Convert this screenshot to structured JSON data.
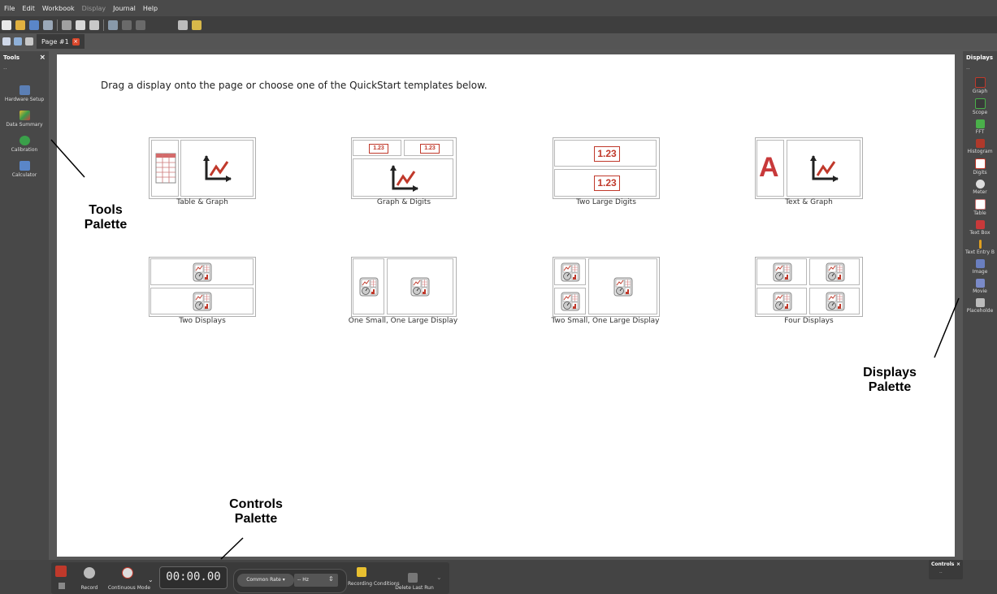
{
  "menu": [
    "File",
    "Edit",
    "Workbook",
    "Display",
    "Journal",
    "Help"
  ],
  "tab": {
    "label": "Page #1",
    "close": "×"
  },
  "tools_palette": {
    "title": "Tools",
    "close": "×",
    "dots": "..",
    "items": [
      {
        "label": "Hardware Setup",
        "icon": "hardware-setup-icon"
      },
      {
        "label": "Data Summary",
        "icon": "data-summary-icon"
      },
      {
        "label": "Calibration",
        "icon": "calibration-icon"
      },
      {
        "label": "Calculator",
        "icon": "calculator-icon"
      }
    ]
  },
  "instruction": "Drag a display onto the page or choose one of the QuickStart templates below.",
  "templates": [
    {
      "label": "Table & Graph"
    },
    {
      "label": "Graph & Digits",
      "digit": "1.23"
    },
    {
      "label": "Two Large Digits",
      "digit": "1.23"
    },
    {
      "label": "Text & Graph",
      "letter": "A"
    },
    {
      "label": "Two Displays"
    },
    {
      "label": "One Small, One Large Display"
    },
    {
      "label": "Two Small, One Large Display"
    },
    {
      "label": "Four Displays"
    }
  ],
  "displays_palette": {
    "title": "Displays",
    "dots": "..",
    "items": [
      {
        "label": "Graph",
        "icon": "graph-icon"
      },
      {
        "label": "Scope",
        "icon": "scope-icon"
      },
      {
        "label": "FFT",
        "icon": "fft-icon"
      },
      {
        "label": "Histogram",
        "icon": "histogram-icon"
      },
      {
        "label": "Digits",
        "icon": "digits-icon"
      },
      {
        "label": "Meter",
        "icon": "meter-icon"
      },
      {
        "label": "Table",
        "icon": "table-icon"
      },
      {
        "label": "Text Box",
        "icon": "text-box-icon"
      },
      {
        "label": "Text Entry B",
        "icon": "text-entry-icon"
      },
      {
        "label": "Image",
        "icon": "image-icon"
      },
      {
        "label": "Movie",
        "icon": "movie-icon"
      },
      {
        "label": "Placeholde",
        "icon": "placeholder-icon"
      }
    ]
  },
  "controls": {
    "record": "Record",
    "continuous_mode": "Continuous Mode",
    "timer": "00:00.00",
    "rate": "Common Rate ▾",
    "hz": "-- Hz",
    "recording_conditions": "Recording Conditions",
    "delete_last_run": "Delete Last Run",
    "palette_title": "Controls",
    "palette_close": "×",
    "palette_dots": ".."
  },
  "annotations": {
    "tools": "Tools Palette",
    "displays": "Displays Palette",
    "controls": "Controls Palette"
  },
  "colors": {
    "accent_red": "#c0392b",
    "menubar": "#4a4a4a",
    "palette": "#484848"
  }
}
